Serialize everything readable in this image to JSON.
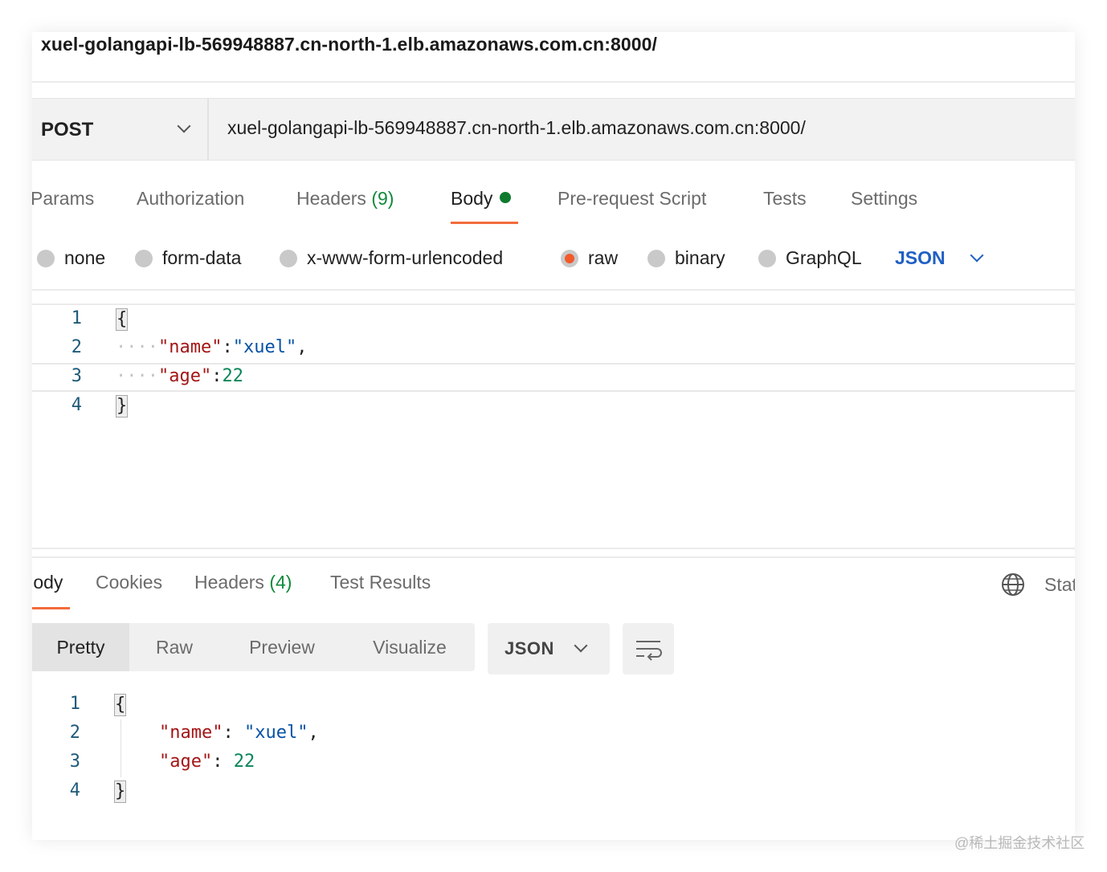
{
  "request": {
    "title": "xuel-golangapi-lb-569948887.cn-north-1.elb.amazonaws.com.cn:8000/",
    "method": "POST",
    "url": "xuel-golangapi-lb-569948887.cn-north-1.elb.amazonaws.com.cn:8000/"
  },
  "request_tabs": [
    {
      "label": "Params"
    },
    {
      "label": "Authorization"
    },
    {
      "label": "Headers",
      "count": "(9)"
    },
    {
      "label": "Body",
      "active": true,
      "indicator": "green-dot"
    },
    {
      "label": "Pre-request Script"
    },
    {
      "label": "Tests"
    },
    {
      "label": "Settings"
    }
  ],
  "body_types": [
    {
      "label": "none",
      "selected": false
    },
    {
      "label": "form-data",
      "selected": false
    },
    {
      "label": "x-www-form-urlencoded",
      "selected": false
    },
    {
      "label": "raw",
      "selected": true
    },
    {
      "label": "binary",
      "selected": false
    },
    {
      "label": "GraphQL",
      "selected": false
    }
  ],
  "raw_language": "JSON",
  "request_editor": {
    "line_numbers": [
      "1",
      "2",
      "3",
      "4"
    ],
    "open_brace": "{",
    "close_brace": "}",
    "indent": "····",
    "name_key": "\"name\"",
    "name_sep": ":",
    "name_value": "\"xuel\"",
    "comma": ",",
    "age_key": "\"age\"",
    "age_sep": ":",
    "age_value": "22"
  },
  "response_tabs": [
    {
      "label": "Body",
      "active": true
    },
    {
      "label": "Cookies"
    },
    {
      "label": "Headers",
      "count": "(4)"
    },
    {
      "label": "Test Results"
    }
  ],
  "response_status_label": "Status",
  "view_modes": [
    {
      "label": "Pretty",
      "active": true
    },
    {
      "label": "Raw"
    },
    {
      "label": "Preview"
    },
    {
      "label": "Visualize"
    }
  ],
  "response_format": "JSON",
  "response_editor": {
    "line_numbers": [
      "1",
      "2",
      "3",
      "4"
    ],
    "open_brace": "{",
    "close_brace": "}",
    "name_key": "\"name\"",
    "name_sep": ": ",
    "name_value": "\"xuel\"",
    "comma": ",",
    "age_key": "\"age\"",
    "age_sep": ": ",
    "age_value": "22"
  },
  "watermark": "@稀土掘金技术社区",
  "colors": {
    "accent_underline": "#f26b3a",
    "radio_selected": "#f25a2a",
    "link_blue": "#1f5fc4",
    "count_green": "#0f8a3b",
    "json_key": "#a31515",
    "json_string": "#0451a5",
    "json_number": "#098658"
  }
}
